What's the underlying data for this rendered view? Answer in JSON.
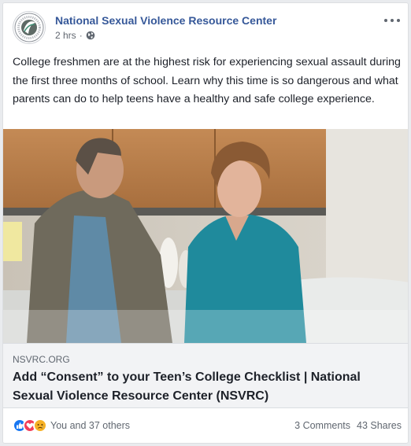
{
  "post": {
    "page_name": "National Sexual Violence Resource Center",
    "timestamp": "2 hrs",
    "audience_icon": "globe-icon",
    "text": "College freshmen are at the highest risk for experiencing sexual assault during the first three months of school. Learn why this time is so dangerous and what parents can do to help teens have a healthy and safe college experience."
  },
  "link_preview": {
    "domain": "NSVRC.ORG",
    "title": "Add “Consent” to your Teen’s College Checklist | National Sexual Violence Resource Center (NSVRC)"
  },
  "footer": {
    "reactions": [
      "like-icon",
      "love-icon",
      "sad-icon"
    ],
    "reaction_text": "You and 37 others",
    "comments": "3 Comments",
    "shares": "43 Shares"
  },
  "colors": {
    "page_name": "#365899",
    "like": "#1877f2",
    "love": "#f33e58",
    "sad": "#f7b125"
  }
}
